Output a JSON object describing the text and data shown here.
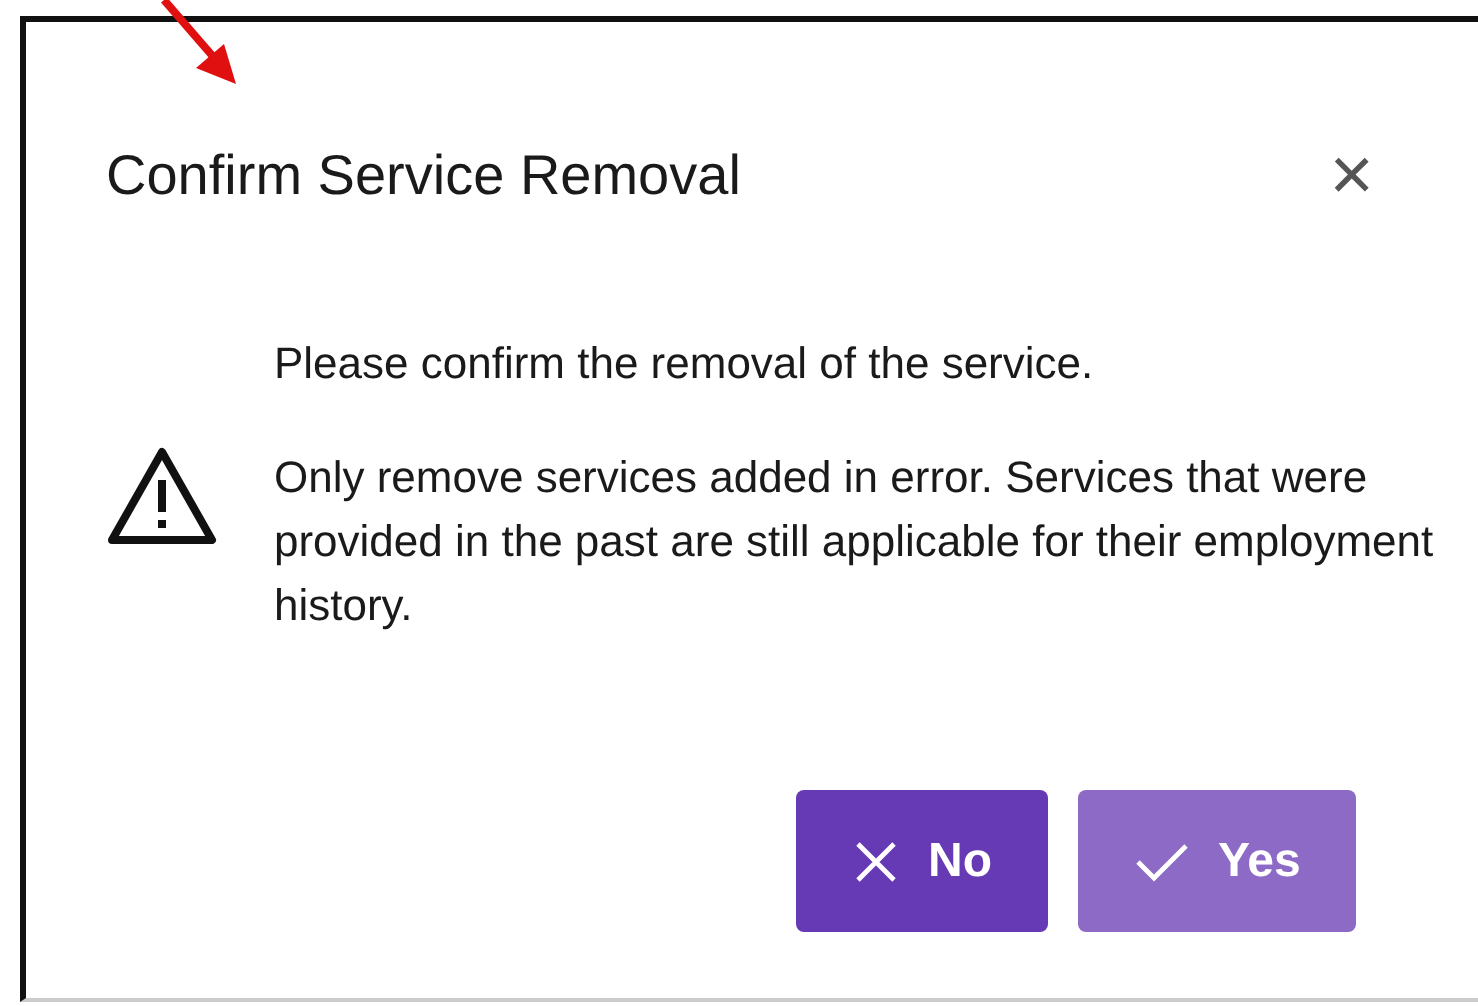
{
  "dialog": {
    "title": "Confirm Service Removal",
    "close": "×",
    "message": "Please confirm the removal of the service.",
    "warning": "Only remove services added in error. Services that were provided in the past are still applicable for their employment history.",
    "buttons": [
      {
        "kind": "cancel",
        "label": "No",
        "disabled": false
      },
      {
        "kind": "confirm",
        "label": "Yes",
        "disabled": true
      }
    ]
  }
}
